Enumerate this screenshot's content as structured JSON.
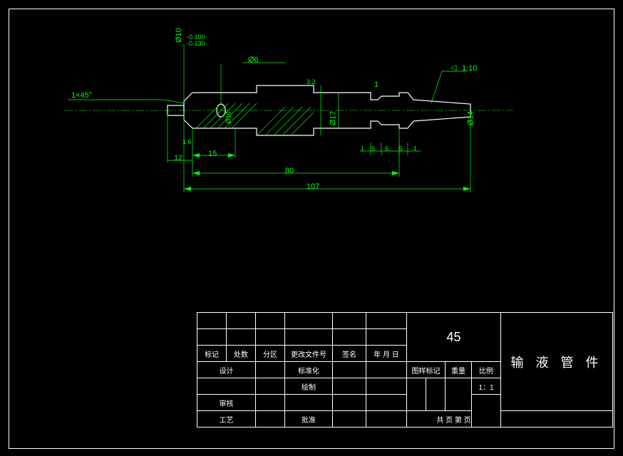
{
  "dimensions": {
    "chamfer": "1×45°",
    "roughness1": "1.6",
    "dia_tol": "Ø10",
    "tol_values": "-0.100\n-0.130",
    "dia6": "Ø6",
    "rough32": "3.2",
    "dia10_small": "Ø10",
    "dia17": "Ø17",
    "dia14": "Ø14",
    "taper": "1:10",
    "taper_sym": "◁",
    "gap1": "1",
    "len12": "12",
    "len15": "15",
    "len80": "80",
    "len107": "107",
    "seg5a": "5",
    "seg5b": "5",
    "seg5c": "5",
    "seg1a": "1",
    "seg1b": "1"
  },
  "title_block": {
    "material": "45",
    "part_name": "输 液 管 件",
    "headers": {
      "mark": "标记",
      "qty": "处数",
      "zone": "分区",
      "change": "更改文件号",
      "sign": "签名",
      "date": "年 月 日"
    },
    "rows": {
      "design": "设计",
      "std": "标准化",
      "draw": "绘制",
      "check": "审核",
      "process": "工艺",
      "approve": "批准"
    },
    "info": {
      "drawing_mark": "图样标记",
      "weight": "重量",
      "scale": "比例",
      "scale_val": "1：1",
      "pages": "共 页   第 页"
    }
  }
}
